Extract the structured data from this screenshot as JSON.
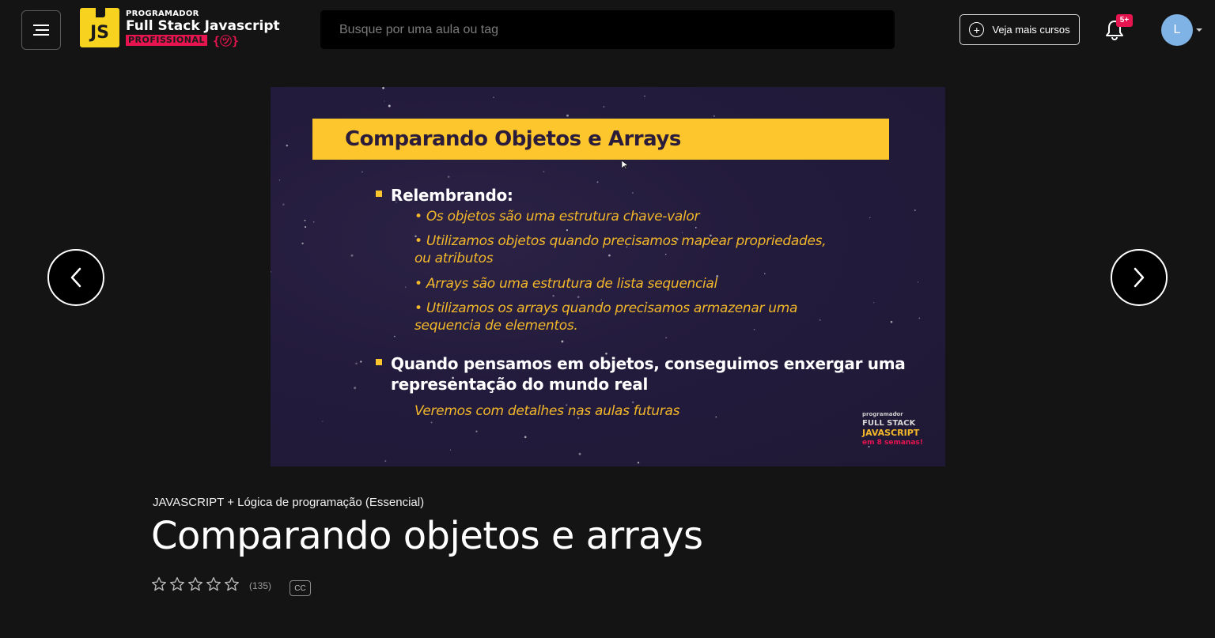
{
  "header": {
    "logo": {
      "badge": "JS",
      "top_line": "PROGRAMADOR",
      "main_line": "Full Stack Javascript",
      "bottom_line": "PROFISSIONAL",
      "brace": "{㋡}"
    },
    "search": {
      "placeholder": "Busque por uma aula ou tag",
      "value": ""
    },
    "more_courses_label": "Veja mais cursos",
    "notifications_badge": "5+",
    "avatar_initial": "L"
  },
  "video": {
    "slide": {
      "title": "Comparando Objetos e Arrays",
      "bullets": [
        {
          "heading": "Relembrando:",
          "items": [
            "• Os objetos são uma estrutura chave-valor",
            "• Utilizamos objetos quando precisamos mapear propriedades,",
            "ou atributos",
            "• Arrays são uma estrutura de lista sequencial",
            "• Utilizamos os arrays quando precisamos armazenar uma",
            "sequencia de elementos."
          ]
        },
        {
          "heading_line1": "Quando pensamos em objetos, conseguimos enxergar uma",
          "heading_line2": "representação do mundo real",
          "items": [
            "Veremos com detalhes nas aulas futuras"
          ]
        }
      ],
      "watermark": {
        "line1": "programador",
        "line2": "FULL STACK",
        "line3": "JAVASCRIPT",
        "line4": "em 8 semanas!"
      }
    }
  },
  "lesson": {
    "course": "JAVASCRIPT + Lógica de programação (Essencial)",
    "title": "Comparando objetos e arrays",
    "rating_count": "(135)",
    "rating_stars": 0,
    "cc_label": "CC"
  }
}
